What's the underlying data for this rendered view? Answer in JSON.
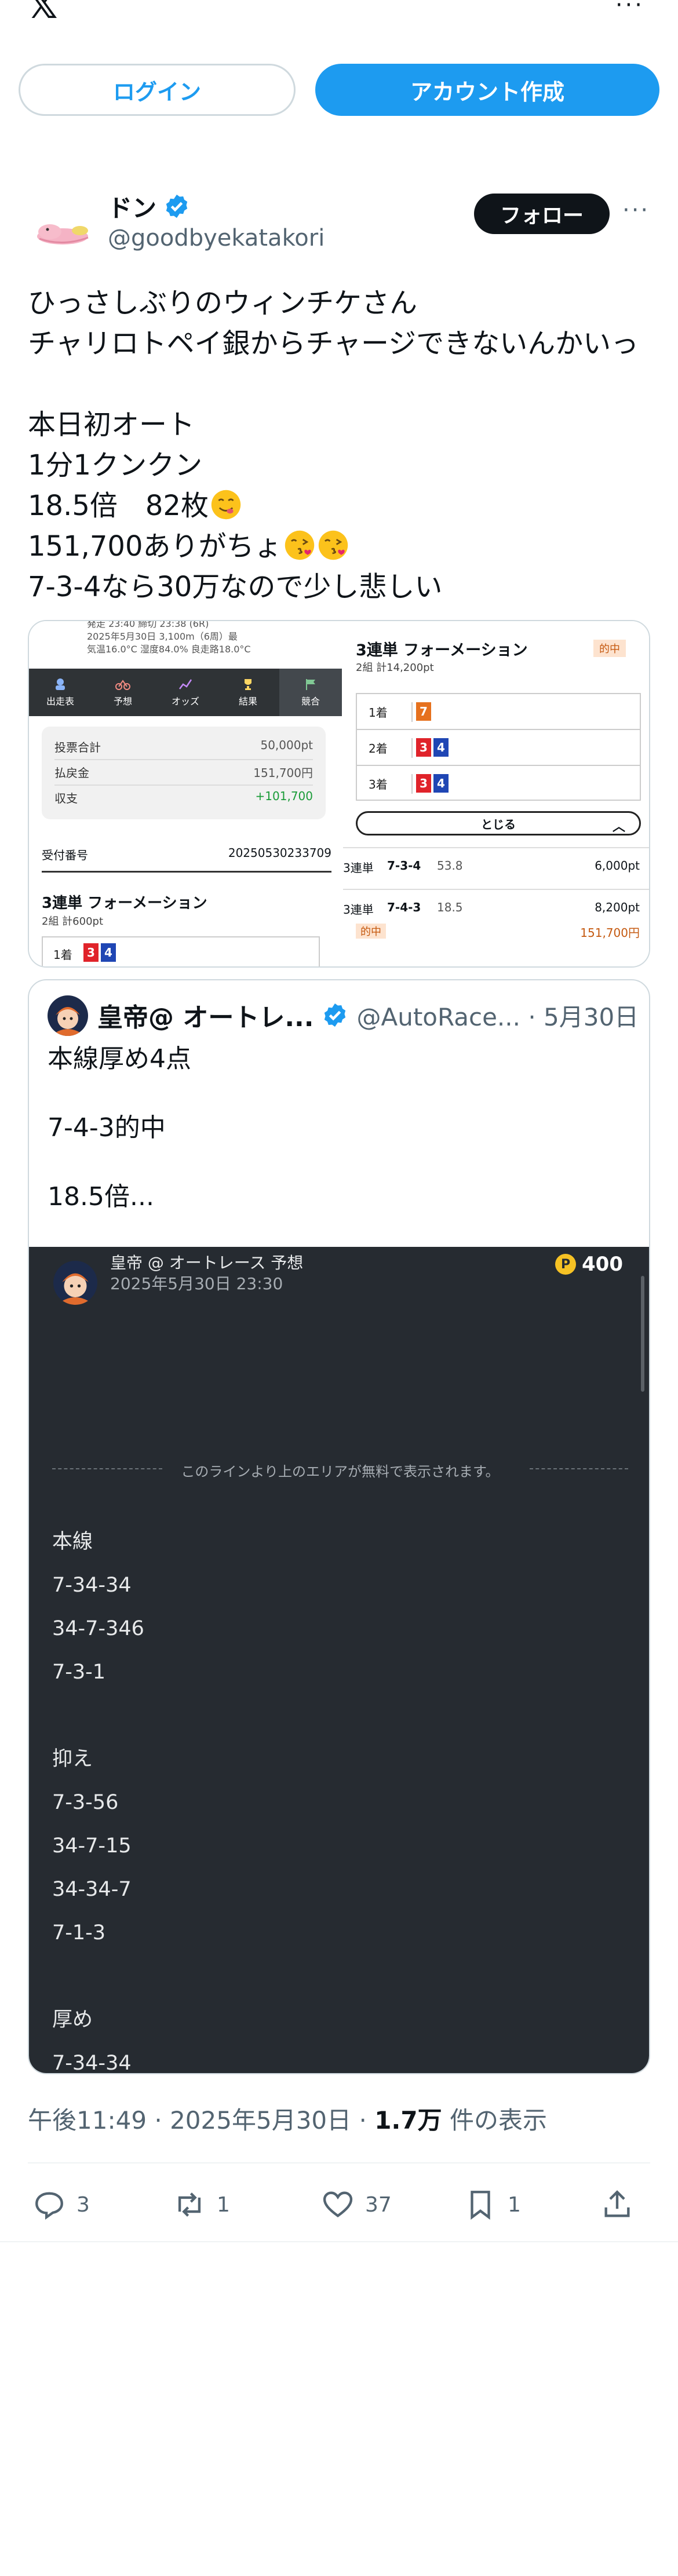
{
  "header": {
    "logo": "𝕏",
    "more": "···"
  },
  "auth": {
    "login_label": "ログイン",
    "signup_label": "アカウント作成"
  },
  "post": {
    "display_name": "ドン",
    "handle": "@goodbyekatakori",
    "follow_label": "フォロー",
    "more": "···",
    "text_lines": [
      "ひっさしぶりのウィンチケさん",
      "チャリロトペイ銀からチャージできないんかいっ",
      "",
      "本日初オート",
      "1分1クンクン",
      "18.5倍　82枚",
      "151,700ありがちょ",
      "7-3-4なら30万なので少し悲しい"
    ],
    "timestamp": "午後11:49 · 2025年5月30日 · ",
    "views_count": "1.7万",
    "views_label": " 件の表示"
  },
  "media": {
    "left": {
      "header_lines": [
        "発走 23:40 締切 23:38 (6R)",
        "2025年5月30日 3,100m（6周）最",
        "気温16.0°C 湿度84.0% 良走路18.0°C"
      ],
      "nav": [
        "出走表",
        "予想",
        "オッズ",
        "結果",
        "競合"
      ],
      "summary": [
        {
          "label": "投票合計",
          "value": "50,000pt"
        },
        {
          "label": "払戻金",
          "value": "151,700円"
        },
        {
          "label": "収支",
          "value": "+101,700"
        }
      ],
      "receipt_label": "受付番号",
      "receipt_value": "20250530233709",
      "form_title": "3連単 フォーメーション",
      "form_sub": "2組 計600pt",
      "first_place": "1着",
      "first_nums": [
        "3",
        "4"
      ]
    },
    "right": {
      "title": "3連単 フォーメーション",
      "sub": "2組 計14,200pt",
      "hit_badge": "的中",
      "rows": [
        {
          "place": "1着",
          "nums": [
            "7"
          ]
        },
        {
          "place": "2着",
          "nums": [
            "3",
            "4"
          ]
        },
        {
          "place": "3着",
          "nums": [
            "3",
            "4"
          ]
        }
      ],
      "close_label": "とじる",
      "bets": [
        {
          "type": "3連単",
          "combo": "7-3-4",
          "odds": "53.8",
          "amount": "6,000pt"
        },
        {
          "type": "3連単",
          "combo": "7-4-3",
          "odds": "18.5",
          "amount": "8,200pt"
        }
      ],
      "hit_label": "的中",
      "payout": "151,700円"
    }
  },
  "quote": {
    "display_name": "皇帝@ オートレ...",
    "handle": "@AutoRace... · 5月30日",
    "text_lines": [
      "本線厚め4点",
      "",
      "7-4-3的中",
      "",
      "18.5倍..."
    ],
    "image": {
      "name": "皇帝 @ オートレース 予想",
      "date": "2025年5月30日 23:30",
      "points": "400",
      "coin": "P",
      "divider_text": "このラインより上のエリアが無料で表示されます。",
      "picks": [
        "本線",
        "7-34-34",
        "34-7-346",
        "7-3-1",
        "",
        "抑え",
        "7-3-56",
        "34-7-15",
        "34-34-7",
        "7-1-3",
        "",
        "厚め",
        "7-34-34"
      ]
    }
  },
  "actions": {
    "replies": "3",
    "reposts": "1",
    "likes": "37",
    "bookmarks": "1"
  },
  "colors": {
    "accent": "#1d9bf0",
    "text": "#0f1419",
    "muted": "#536471",
    "border": "#cfd9de",
    "dark_panel": "#262b31"
  }
}
